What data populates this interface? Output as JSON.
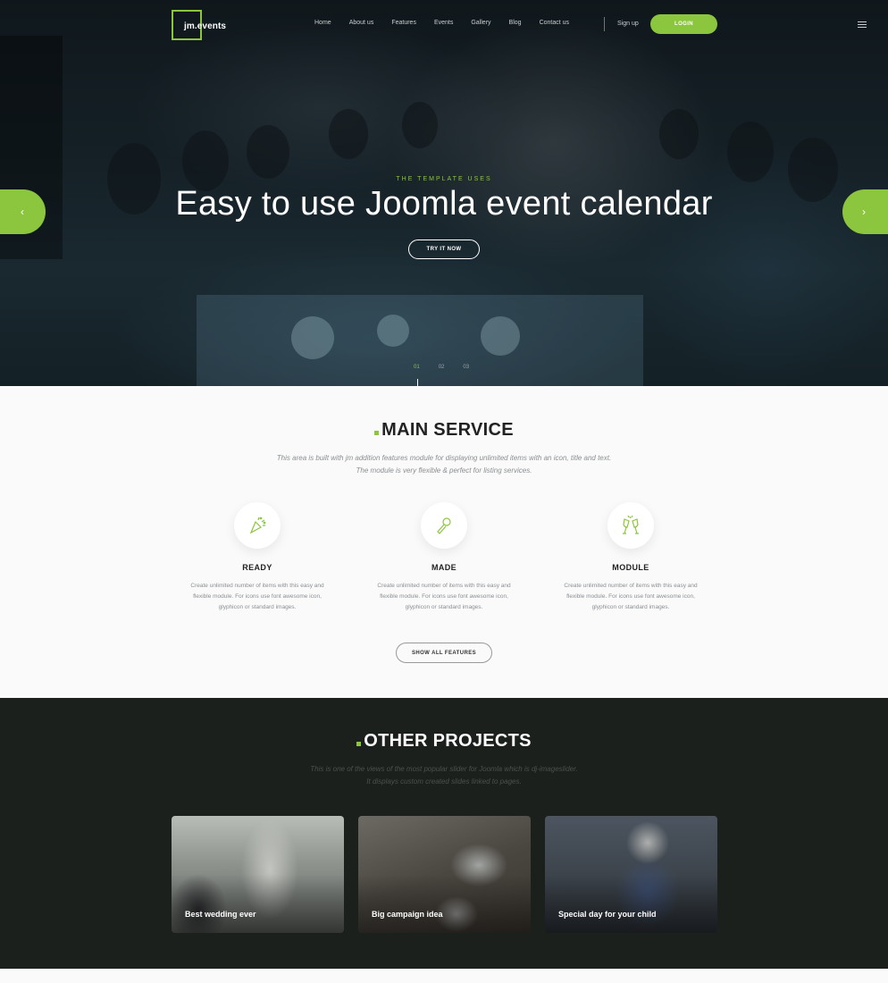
{
  "brand": {
    "logo_text": "jm.events",
    "accent": "#8cc63f"
  },
  "nav": {
    "items": [
      "Home",
      "About us",
      "Features",
      "Events",
      "Gallery",
      "Blog",
      "Contact us"
    ],
    "signup": "Sign up",
    "login": "LOGIN"
  },
  "hero": {
    "eyebrow": "THE TEMPLATE USES",
    "headline": "Easy to use Joomla event calendar",
    "cta": "TRY IT NOW",
    "prev_icon": "‹",
    "next_icon": "›",
    "slides": [
      "01",
      "02",
      "03"
    ]
  },
  "service": {
    "title": "MAIN SERVICE",
    "subtitle_line1": "This area is built with jm addition features module for displaying unlimited items with an icon, title and text.",
    "subtitle_line2": "The module is very flexible & perfect for listing services.",
    "features": [
      {
        "icon": "party-popper-icon",
        "title": "READY",
        "desc1": "Create unlimited number of items with this easy and",
        "desc2": "flexible module. For icons use font awesome icon,",
        "desc3": "glyphicon or standard images."
      },
      {
        "icon": "microphone-icon",
        "title": "MADE",
        "desc1": "Create unlimited number of items with this easy and",
        "desc2": "flexible module. For icons use font awesome icon,",
        "desc3": "glyphicon or standard images."
      },
      {
        "icon": "champagne-glasses-icon",
        "title": "MODULE",
        "desc1": "Create unlimited number of items with this easy and",
        "desc2": "flexible module. For icons use font awesome icon,",
        "desc3": "glyphicon or standard images."
      }
    ],
    "show_all": "SHOW ALL FEATURES"
  },
  "projects": {
    "title": "OTHER PROJECTS",
    "subtitle_line1": "This is one of the views of the most popular slider for Joomla which is dj-imageslider.",
    "subtitle_line2": "It displays custom created slides linked to pages.",
    "cards": [
      {
        "label": "Best wedding ever"
      },
      {
        "label": "Big campaign idea"
      },
      {
        "label": "Special day for your child"
      }
    ]
  }
}
